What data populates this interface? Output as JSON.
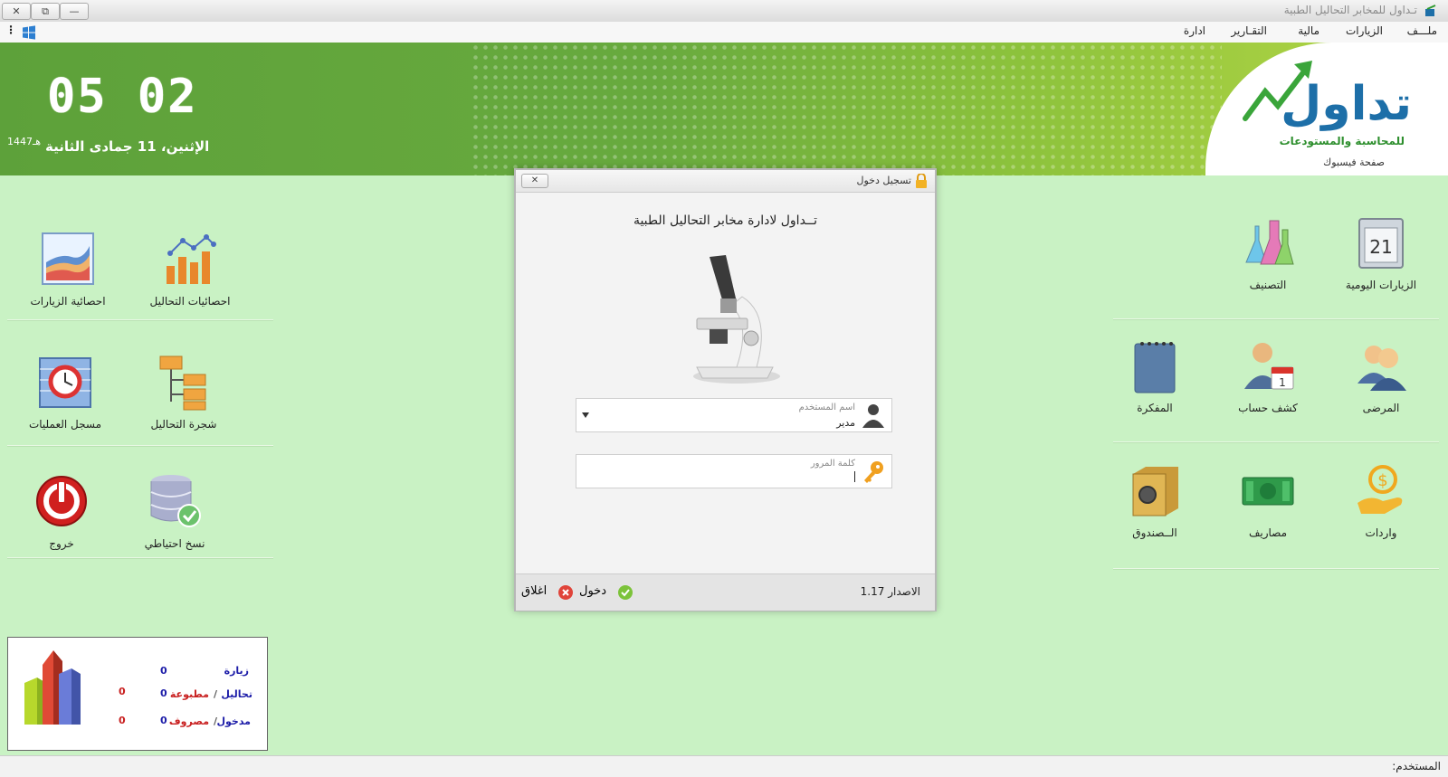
{
  "window": {
    "title": "تـداول للمخابر التحاليل الطبية",
    "close_glyph": "✕",
    "restore_glyph": "⧉",
    "minimize_glyph": "—"
  },
  "menu": {
    "items": [
      "ملـــف",
      "الزيارات",
      "مالية",
      "التقـارير",
      "ادارة"
    ],
    "more_glyph": "⋮"
  },
  "banner": {
    "clock": "05 02",
    "weekday": "الإثنين،",
    "date": "11 جمادى الثانية",
    "hijri_year": "1447هـ",
    "logo_text": "تداول",
    "logo_subtitle": "للمحاسبة والمستودعات",
    "facebook_link": "صفحة فيسبوك"
  },
  "right_tiles": [
    {
      "label": "الزيارات اليومية",
      "icon": "calendar-icon"
    },
    {
      "label": "التصنيف",
      "icon": "flasks-icon"
    },
    {
      "label": "المرضى",
      "icon": "users-icon"
    },
    {
      "label": "كشف حساب",
      "icon": "account-statement-icon"
    },
    {
      "label": "المفكرة",
      "icon": "notepad-icon"
    },
    {
      "label": "واردات",
      "icon": "income-icon"
    },
    {
      "label": "مصاريف",
      "icon": "cash-icon"
    },
    {
      "label": "الــصندوق",
      "icon": "safe-icon"
    }
  ],
  "left_tiles": [
    {
      "label": "احصائيات التحاليل",
      "icon": "bar-chart-icon"
    },
    {
      "label": "احصائية الزيارات",
      "icon": "area-chart-icon"
    },
    {
      "label": "شجرة التحاليل",
      "icon": "tree-icon"
    },
    {
      "label": "مسجل العمليات",
      "icon": "clock-log-icon"
    },
    {
      "label": "نسخ احتياطي",
      "icon": "database-backup-icon"
    },
    {
      "label": "خروج",
      "icon": "power-icon"
    }
  ],
  "stats": {
    "visit_label": "زيارة",
    "visit_value": "0",
    "tests_label": "تحاليل",
    "tests_value": "0",
    "printed_label": "مطبوعة",
    "printed_value": "0",
    "income_label": "مدخول",
    "income_value": "0",
    "expense_label": "مصروف",
    "expense_value": "0",
    "slash": "/"
  },
  "status": {
    "user_label": "المستخدم:"
  },
  "dialog": {
    "title": "تسجيل دخول",
    "close_glyph": "✕",
    "heading": "تــداول لادارة مخابر التحاليل الطبية",
    "username_placeholder": "اسم المستخدم",
    "username_value": "مدير",
    "password_placeholder": "كلمة المرور",
    "version_label": "الاصدار 1.17",
    "login_label": "دخول",
    "close_label": "اغلاق"
  },
  "colors": {
    "banner_green": "#63a63c",
    "logo_blue": "#1d6fa8",
    "stats_blue": "#1c1ca8",
    "stats_red": "#c81e1e"
  }
}
